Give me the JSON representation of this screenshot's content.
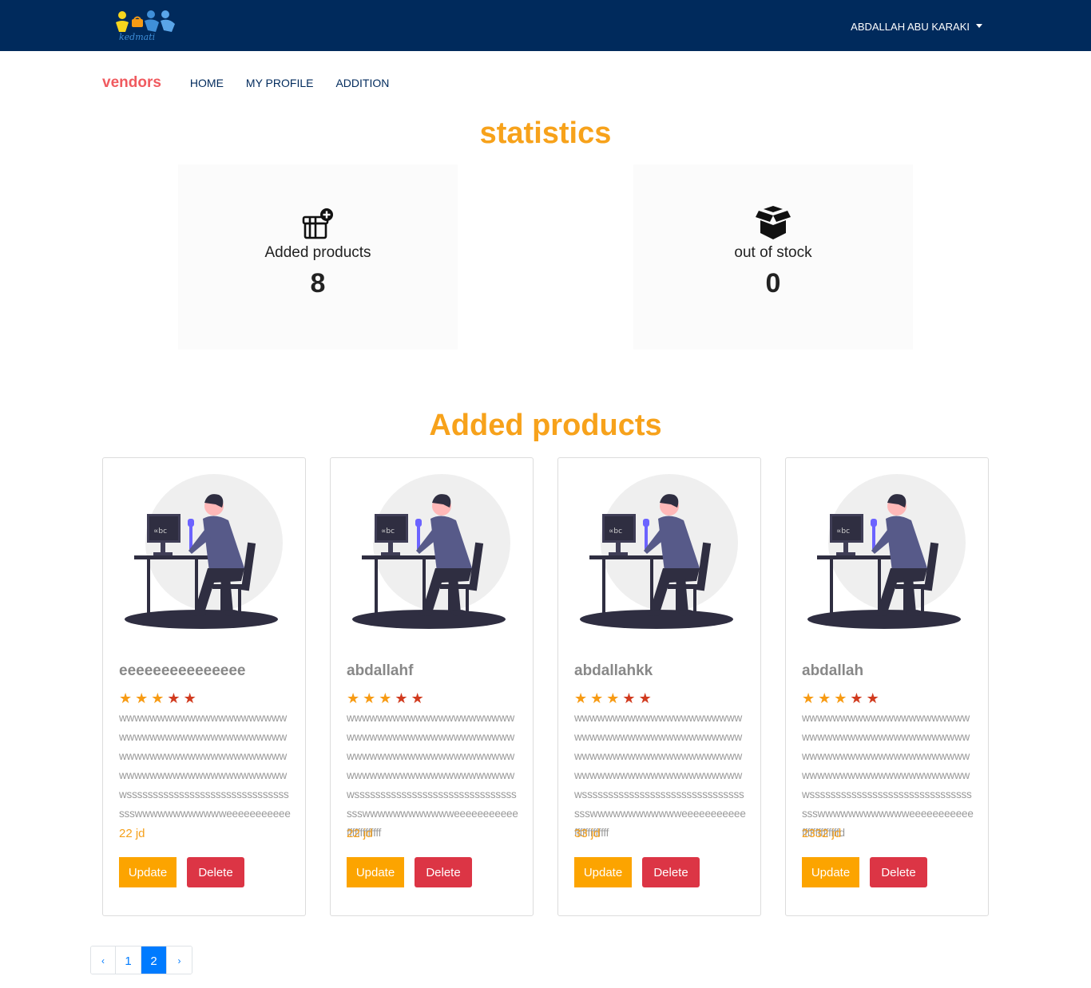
{
  "header": {
    "logo_text": "kedmati",
    "user_name": "ABDALLAH ABU KARAKI"
  },
  "subnav": {
    "brand": "vendors",
    "links": [
      "HOME",
      "MY PROFILE",
      "ADDITION"
    ]
  },
  "statistics": {
    "title": "statistics",
    "cards": [
      {
        "label": "Added products",
        "value": "8",
        "icon": "gift-plus-icon"
      },
      {
        "label": "out of stock",
        "value": "0",
        "icon": "open-box-icon"
      }
    ]
  },
  "products": {
    "title": "Added products",
    "items": [
      {
        "name": "eeeeeeeeeeeeeee",
        "description": "wwwwwwwwwwwwwwwwwwwwwwwwwwwwwwwwwwwwwwwwwwwwwwwwwwwwwwwwwwwwwwwwwwwwwwwwwwwwwwwwwwwwwwwwwsssssssssssssssssssssssssssssssssswwwwwwwwwwwweeeeeeeeeee",
        "price": "22 jd",
        "rating": 5,
        "update_label": "Update",
        "delete_label": "Delete"
      },
      {
        "name": "abdallahf",
        "description": "wwwwwwwwwwwwwwwwwwwwwwwwwwwwwwwwwwwwwwwwwwwwwwwwwwwwwwwwwwwwwwwwwwwwwwwwwwwwwwwwwwwwwwwwwsssssssssssssssssssssssssssssssssswwwwwwwwwwwweeeeeeeeeeefffffffffffff",
        "price": "22 jd",
        "rating": 5,
        "update_label": "Update",
        "delete_label": "Delete"
      },
      {
        "name": "abdallahkk",
        "description": "wwwwwwwwwwwwwwwwwwwwwwwwwwwwwwwwwwwwwwwwwwwwwwwwwwwwwwwwwwwwwwwwwwwwwwwwwwwwwwwwwwwwwwwwwsssssssssssssssssssssssssssssssssswwwwwwwwwwwweeeeeeeeeeefffffffffffff",
        "price": "33 jd",
        "rating": 5,
        "update_label": "Update",
        "delete_label": "Delete"
      },
      {
        "name": "abdallah",
        "description": "wwwwwwwwwwwwwwwwwwwwwwwwwwwwwwwwwwwwwwwwwwwwwwwwwwwwwwwwwwwwwwwwwwwwwwwwwwwwwwwwwwwwwwwwwsssssssssssssssssssssssssssssssssswwwwwwwwwwwweeeeeeeeeeeffffffffffffffd",
        "price": "2332 jd",
        "rating": 5,
        "update_label": "Update",
        "delete_label": "Delete"
      }
    ]
  },
  "pagination": {
    "prev": "‹",
    "pages": [
      "1",
      "2"
    ],
    "active_page": "2",
    "next": "›"
  },
  "colors": {
    "navbar": "#002a5c",
    "accent": "#f7a21b",
    "brand": "#f05a5f",
    "update_button": "#fca400",
    "delete_button": "#dc3545",
    "page_active": "#007bff"
  }
}
